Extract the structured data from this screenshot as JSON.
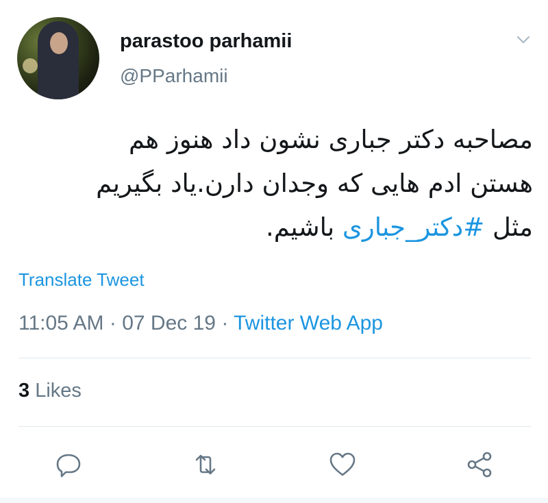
{
  "tweet": {
    "author_name": "parastoo parhamii",
    "author_handle": "@PParhamii",
    "text_line1": "مصاحبه دکتر جباری نشون داد هنوز هم",
    "text_line2": "هستن ادم هایی که وجدان دارن.یاد بگیریم",
    "text_line3_prefix": "مثل ",
    "hashtag": "#دکتر_جباری",
    "text_line3_suffix": " باشیم.",
    "translate_label": "Translate Tweet",
    "time": "11:05 AM",
    "date": "07 Dec 19",
    "source": "Twitter Web App",
    "likes_count": "3",
    "likes_label": "Likes"
  },
  "icons": {
    "menu": "chevron-down-icon",
    "reply": "reply-icon",
    "retweet": "retweet-icon",
    "like": "heart-icon",
    "share": "share-icon"
  },
  "colors": {
    "link": "#1b95e0",
    "secondary_text": "#657786",
    "primary_text": "#14171a",
    "divider": "#e1e8ed"
  }
}
